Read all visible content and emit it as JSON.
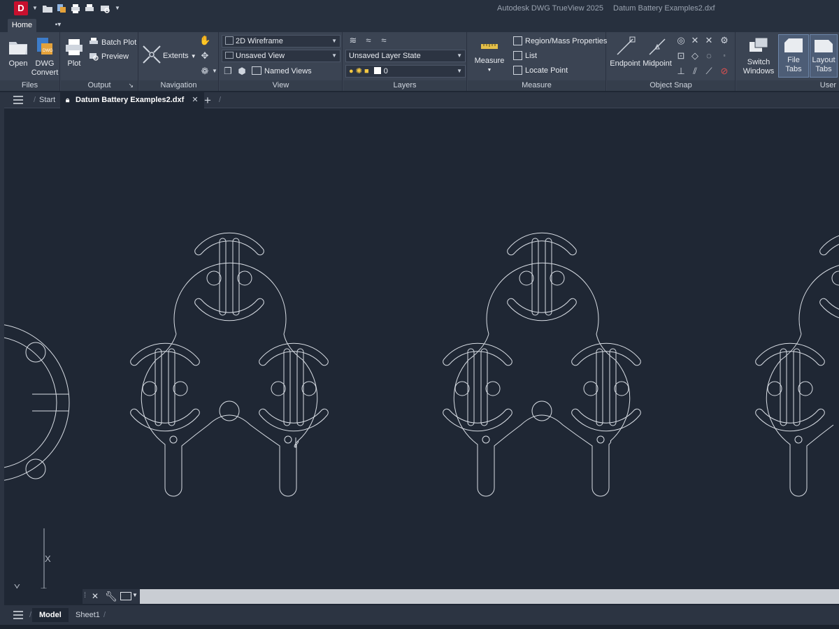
{
  "titlebar": {
    "app_logo": "D",
    "app_name": "Autodesk DWG TrueView 2025",
    "document_name": "Datum Battery Examples2.dxf"
  },
  "ribbon_tabs": {
    "home": "Home"
  },
  "files_panel": {
    "title": "Files",
    "open": "Open",
    "dwg_convert_1": "DWG",
    "dwg_convert_2": "Convert"
  },
  "output_panel": {
    "title": "Output",
    "plot": "Plot",
    "batch_plot": "Batch Plot",
    "preview": "Preview"
  },
  "navigation_panel": {
    "title": "Navigation",
    "extents": "Extents"
  },
  "view_panel": {
    "title": "View",
    "visual_style": "2D Wireframe",
    "saved_view": "Unsaved View",
    "named_views": "Named Views"
  },
  "layers_panel": {
    "title": "Layers",
    "layer_state": "Unsaved Layer State",
    "current_layer": "0"
  },
  "measure_panel": {
    "title": "Measure",
    "measure": "Measure",
    "region_mass": "Region/Mass Properties",
    "list": "List",
    "locate_point": "Locate Point"
  },
  "osnap_panel": {
    "title": "Object Snap",
    "endpoint": "Endpoint",
    "midpoint": "Midpoint"
  },
  "ui_panel": {
    "title": "User",
    "switch_windows_1": "Switch",
    "switch_windows_2": "Windows",
    "file_tabs": "File Tabs",
    "layout_tabs_1": "Layout",
    "layout_tabs_2": "Tabs"
  },
  "file_tabs": {
    "start": "Start",
    "active": "Datum Battery Examples2.dxf"
  },
  "ucs": {
    "x": "X",
    "y": "Y"
  },
  "layout_tabs": {
    "model": "Model",
    "sheet1": "Sheet1"
  },
  "colors": {
    "canvas": "#1f2734",
    "ribbon": "#3b4453",
    "drawing_line": "#d8dde4",
    "accent": "#c8102e"
  }
}
